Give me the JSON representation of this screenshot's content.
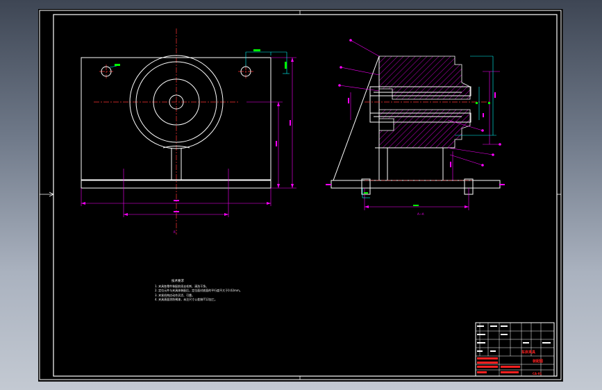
{
  "viewport": {
    "name": "cad-drawing-viewport"
  },
  "colors": {
    "background": "#000000",
    "outline": "#ffffff",
    "dimension": "#ff00ff",
    "centerline": "#ff3333",
    "leader": "#00ffff",
    "hatch": "#ff00ff",
    "text_green": "#00ff00",
    "title_red": "#ff2020"
  },
  "views": {
    "front": {
      "name": "front-view",
      "center_mark": "R"
    },
    "section": {
      "name": "section-view",
      "section_label": "A—A"
    }
  },
  "technical_notes": {
    "title": "技术要求",
    "lines": [
      "1. 夹具各零件装配前须去毛刺、清洗干净。",
      "2. 定位元件与夹具体装配后，定位面对底面的平行度不大于0.02mm。",
      "3. 夹紧机构应动作灵活、可靠。",
      "4. 夹具表面涂防锈漆，未注尺寸公差按IT12加工。"
    ]
  },
  "title_block": {
    "name": "title-block",
    "red_labels": [
      "车床夹具",
      "装配图",
      "CA-01"
    ]
  }
}
